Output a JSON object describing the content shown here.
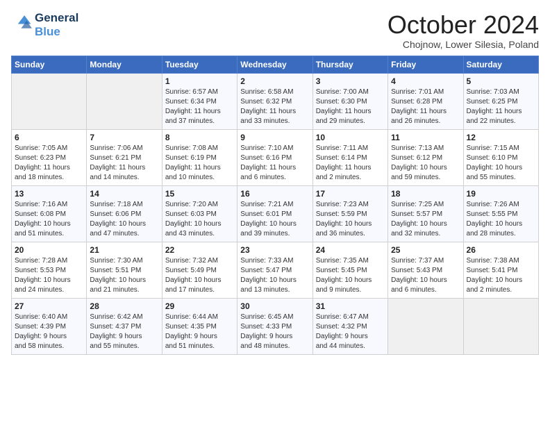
{
  "logo": {
    "line1": "General",
    "line2": "Blue"
  },
  "title": "October 2024",
  "subtitle": "Chojnow, Lower Silesia, Poland",
  "weekdays": [
    "Sunday",
    "Monday",
    "Tuesday",
    "Wednesday",
    "Thursday",
    "Friday",
    "Saturday"
  ],
  "weeks": [
    [
      {
        "day": "",
        "text": ""
      },
      {
        "day": "",
        "text": ""
      },
      {
        "day": "1",
        "text": "Sunrise: 6:57 AM\nSunset: 6:34 PM\nDaylight: 11 hours\nand 37 minutes."
      },
      {
        "day": "2",
        "text": "Sunrise: 6:58 AM\nSunset: 6:32 PM\nDaylight: 11 hours\nand 33 minutes."
      },
      {
        "day": "3",
        "text": "Sunrise: 7:00 AM\nSunset: 6:30 PM\nDaylight: 11 hours\nand 29 minutes."
      },
      {
        "day": "4",
        "text": "Sunrise: 7:01 AM\nSunset: 6:28 PM\nDaylight: 11 hours\nand 26 minutes."
      },
      {
        "day": "5",
        "text": "Sunrise: 7:03 AM\nSunset: 6:25 PM\nDaylight: 11 hours\nand 22 minutes."
      }
    ],
    [
      {
        "day": "6",
        "text": "Sunrise: 7:05 AM\nSunset: 6:23 PM\nDaylight: 11 hours\nand 18 minutes."
      },
      {
        "day": "7",
        "text": "Sunrise: 7:06 AM\nSunset: 6:21 PM\nDaylight: 11 hours\nand 14 minutes."
      },
      {
        "day": "8",
        "text": "Sunrise: 7:08 AM\nSunset: 6:19 PM\nDaylight: 11 hours\nand 10 minutes."
      },
      {
        "day": "9",
        "text": "Sunrise: 7:10 AM\nSunset: 6:16 PM\nDaylight: 11 hours\nand 6 minutes."
      },
      {
        "day": "10",
        "text": "Sunrise: 7:11 AM\nSunset: 6:14 PM\nDaylight: 11 hours\nand 2 minutes."
      },
      {
        "day": "11",
        "text": "Sunrise: 7:13 AM\nSunset: 6:12 PM\nDaylight: 10 hours\nand 59 minutes."
      },
      {
        "day": "12",
        "text": "Sunrise: 7:15 AM\nSunset: 6:10 PM\nDaylight: 10 hours\nand 55 minutes."
      }
    ],
    [
      {
        "day": "13",
        "text": "Sunrise: 7:16 AM\nSunset: 6:08 PM\nDaylight: 10 hours\nand 51 minutes."
      },
      {
        "day": "14",
        "text": "Sunrise: 7:18 AM\nSunset: 6:06 PM\nDaylight: 10 hours\nand 47 minutes."
      },
      {
        "day": "15",
        "text": "Sunrise: 7:20 AM\nSunset: 6:03 PM\nDaylight: 10 hours\nand 43 minutes."
      },
      {
        "day": "16",
        "text": "Sunrise: 7:21 AM\nSunset: 6:01 PM\nDaylight: 10 hours\nand 39 minutes."
      },
      {
        "day": "17",
        "text": "Sunrise: 7:23 AM\nSunset: 5:59 PM\nDaylight: 10 hours\nand 36 minutes."
      },
      {
        "day": "18",
        "text": "Sunrise: 7:25 AM\nSunset: 5:57 PM\nDaylight: 10 hours\nand 32 minutes."
      },
      {
        "day": "19",
        "text": "Sunrise: 7:26 AM\nSunset: 5:55 PM\nDaylight: 10 hours\nand 28 minutes."
      }
    ],
    [
      {
        "day": "20",
        "text": "Sunrise: 7:28 AM\nSunset: 5:53 PM\nDaylight: 10 hours\nand 24 minutes."
      },
      {
        "day": "21",
        "text": "Sunrise: 7:30 AM\nSunset: 5:51 PM\nDaylight: 10 hours\nand 21 minutes."
      },
      {
        "day": "22",
        "text": "Sunrise: 7:32 AM\nSunset: 5:49 PM\nDaylight: 10 hours\nand 17 minutes."
      },
      {
        "day": "23",
        "text": "Sunrise: 7:33 AM\nSunset: 5:47 PM\nDaylight: 10 hours\nand 13 minutes."
      },
      {
        "day": "24",
        "text": "Sunrise: 7:35 AM\nSunset: 5:45 PM\nDaylight: 10 hours\nand 9 minutes."
      },
      {
        "day": "25",
        "text": "Sunrise: 7:37 AM\nSunset: 5:43 PM\nDaylight: 10 hours\nand 6 minutes."
      },
      {
        "day": "26",
        "text": "Sunrise: 7:38 AM\nSunset: 5:41 PM\nDaylight: 10 hours\nand 2 minutes."
      }
    ],
    [
      {
        "day": "27",
        "text": "Sunrise: 6:40 AM\nSunset: 4:39 PM\nDaylight: 9 hours\nand 58 minutes."
      },
      {
        "day": "28",
        "text": "Sunrise: 6:42 AM\nSunset: 4:37 PM\nDaylight: 9 hours\nand 55 minutes."
      },
      {
        "day": "29",
        "text": "Sunrise: 6:44 AM\nSunset: 4:35 PM\nDaylight: 9 hours\nand 51 minutes."
      },
      {
        "day": "30",
        "text": "Sunrise: 6:45 AM\nSunset: 4:33 PM\nDaylight: 9 hours\nand 48 minutes."
      },
      {
        "day": "31",
        "text": "Sunrise: 6:47 AM\nSunset: 4:32 PM\nDaylight: 9 hours\nand 44 minutes."
      },
      {
        "day": "",
        "text": ""
      },
      {
        "day": "",
        "text": ""
      }
    ]
  ]
}
